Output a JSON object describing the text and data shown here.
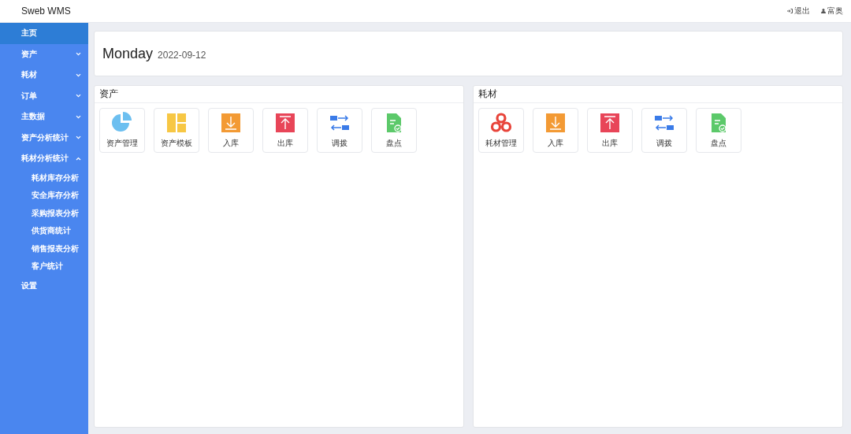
{
  "app_title": "Sweb WMS",
  "header_actions": [
    {
      "kind": "logout",
      "label": "退出"
    },
    {
      "kind": "user",
      "label": "富奥"
    }
  ],
  "sidebar": {
    "items": [
      {
        "label": "主页",
        "selected": true
      },
      {
        "label": "资产",
        "selected": false,
        "expanded": false
      },
      {
        "label": "耗材",
        "selected": false,
        "expanded": false
      },
      {
        "label": "订单",
        "selected": false,
        "expanded": false
      },
      {
        "label": "主数据",
        "selected": false,
        "expanded": false
      },
      {
        "label": "资产分析统计",
        "selected": false,
        "expanded": false
      },
      {
        "label": "耗材分析统计",
        "selected": false,
        "expanded": true,
        "children": [
          {
            "label": "耗材库存分析",
            "selected": false
          },
          {
            "label": "安全库存分析",
            "selected": false
          },
          {
            "label": "采购报表分析",
            "selected": false
          },
          {
            "label": "供货商统计",
            "selected": false
          },
          {
            "label": "销售报表分析",
            "selected": false
          },
          {
            "label": "客户统计",
            "selected": false
          }
        ]
      },
      {
        "label": "设置",
        "selected": false
      }
    ]
  },
  "greeting": {
    "day": "Monday",
    "date": "2022-09-12"
  },
  "panels": [
    {
      "title": "资产",
      "tiles": [
        {
          "kind": "pie",
          "label": "资产管理"
        },
        {
          "kind": "template",
          "label": "资产模板"
        },
        {
          "kind": "inbound",
          "label": "入库"
        },
        {
          "kind": "outbound",
          "label": "出库"
        },
        {
          "kind": "transfer",
          "label": "调拨"
        },
        {
          "kind": "stocktake",
          "label": "盘点"
        }
      ]
    },
    {
      "title": "耗材",
      "tiles": [
        {
          "kind": "consumable",
          "label": "耗材管理"
        },
        {
          "kind": "inbound",
          "label": "入库"
        },
        {
          "kind": "outbound",
          "label": "出库"
        },
        {
          "kind": "transfer",
          "label": "调拨"
        },
        {
          "kind": "stocktake",
          "label": "盘点"
        }
      ]
    }
  ]
}
